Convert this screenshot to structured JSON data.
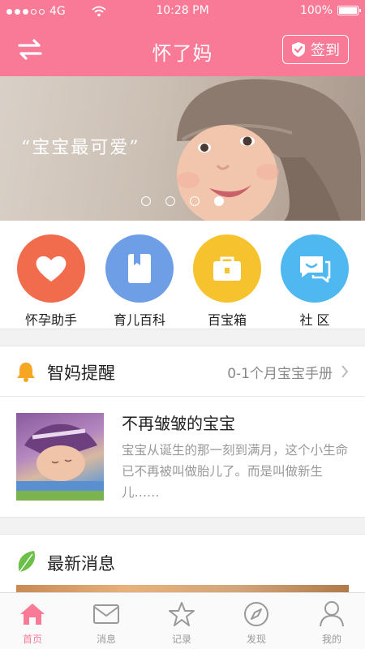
{
  "status_bar": {
    "carrier": "4G",
    "time": "10:28 PM",
    "battery": "100%"
  },
  "nav": {
    "title": "怀了妈",
    "checkin_label": "签到"
  },
  "banner": {
    "slogan": "“宝宝最可爱”",
    "pages": 4,
    "active_page": 4
  },
  "quick_actions": [
    {
      "label": "怀孕助手",
      "icon": "heart-icon",
      "color": "#f16b4d"
    },
    {
      "label": "育儿百科",
      "icon": "book-icon",
      "color": "#6d9ee6"
    },
    {
      "label": "百宝箱",
      "icon": "toolbox-icon",
      "color": "#f6c22d"
    },
    {
      "label": "社 区",
      "icon": "chat-icon",
      "color": "#4fb8f0"
    }
  ],
  "reminder": {
    "title": "智妈提醒",
    "link": "0-1个月宝宝手册",
    "article_title": "不再皱皱的宝宝",
    "article_desc": "宝宝从诞生的那一刻到满月，这个小生命已不再被叫做胎儿了。而是叫做新生儿……"
  },
  "news": {
    "title": "最新消息"
  },
  "tabs": [
    {
      "label": "首页",
      "icon": "home-icon"
    },
    {
      "label": "消息",
      "icon": "mail-icon"
    },
    {
      "label": "记录",
      "icon": "star-icon"
    },
    {
      "label": "发现",
      "icon": "compass-icon"
    },
    {
      "label": "我的",
      "icon": "user-icon"
    }
  ],
  "colors": {
    "brand": "#f97a97",
    "tab_inactive": "#999999",
    "bell": "#f6a623",
    "leaf": "#6cc04a"
  }
}
